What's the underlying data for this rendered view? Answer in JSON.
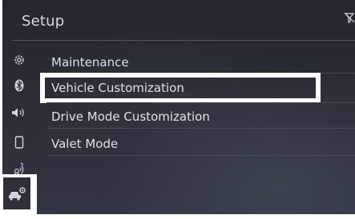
{
  "screen": {
    "title": "Setup",
    "menu": [
      {
        "label": "Maintenance"
      },
      {
        "label": "Vehicle Customization",
        "selected": true
      },
      {
        "label": "Drive Mode Customization"
      },
      {
        "label": "Valet Mode"
      }
    ],
    "sidebar_icons": [
      "gear-icon",
      "bluetooth-icon",
      "speaker-icon",
      "phone-icon",
      "voice-icon",
      "car-settings-icon"
    ],
    "status_icon": "no-signal-icon"
  },
  "colors": {
    "screen_bg": "#2b2e36",
    "text": "#dfe1e6",
    "highlight_border": "#ffffff"
  }
}
